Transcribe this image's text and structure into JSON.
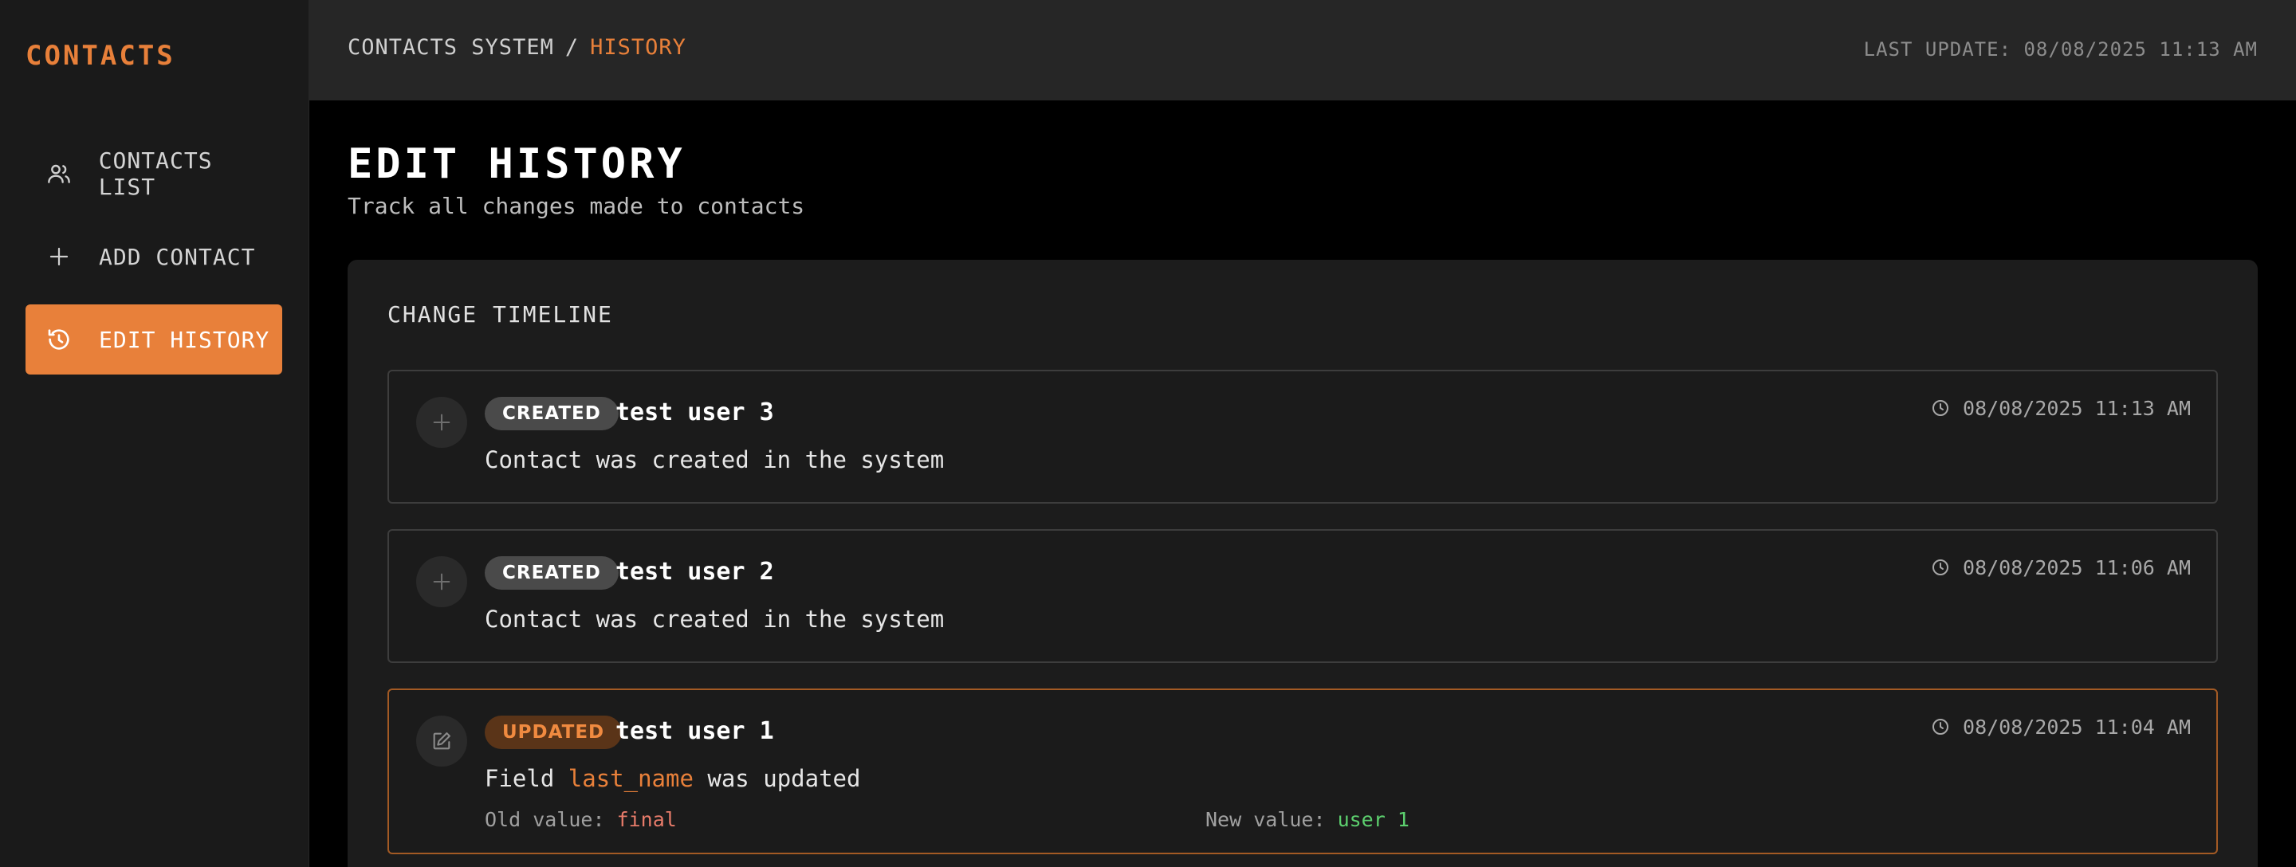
{
  "sidebar": {
    "brand": "CONTACTS",
    "items": [
      {
        "label": "CONTACTS LIST",
        "icon": "users-icon"
      },
      {
        "label": "ADD CONTACT",
        "icon": "plus-icon"
      },
      {
        "label": "EDIT HISTORY",
        "icon": "history-icon",
        "active": true
      }
    ]
  },
  "topbar": {
    "breadcrumb_root": "CONTACTS SYSTEM",
    "breadcrumb_sep": "/",
    "breadcrumb_current": "HISTORY",
    "last_update": "LAST UPDATE: 08/08/2025 11:13 AM"
  },
  "page": {
    "title": "EDIT HISTORY",
    "subtitle": "Track all changes made to contacts"
  },
  "timeline": {
    "title": "CHANGE TIMELINE",
    "entries": [
      {
        "type": "CREATED",
        "name": "test user 3",
        "time": "08/08/2025 11:13 AM",
        "description": "Contact was created in the system",
        "icon": "plus-icon"
      },
      {
        "type": "CREATED",
        "name": "test user 2",
        "time": "08/08/2025 11:06 AM",
        "description": "Contact was created in the system",
        "icon": "plus-icon"
      },
      {
        "type": "UPDATED",
        "name": "test user 1",
        "time": "08/08/2025 11:04 AM",
        "desc_prefix": "Field",
        "field": "last_name",
        "desc_suffix": "was updated",
        "old_label": "Old value:",
        "old_value": "final",
        "new_label": "New value:",
        "new_value": "user 1",
        "icon": "edit-icon"
      }
    ]
  },
  "colors": {
    "accent": "#e8803a",
    "old_value": "#e77b6a",
    "new_value": "#5ccf6e"
  }
}
